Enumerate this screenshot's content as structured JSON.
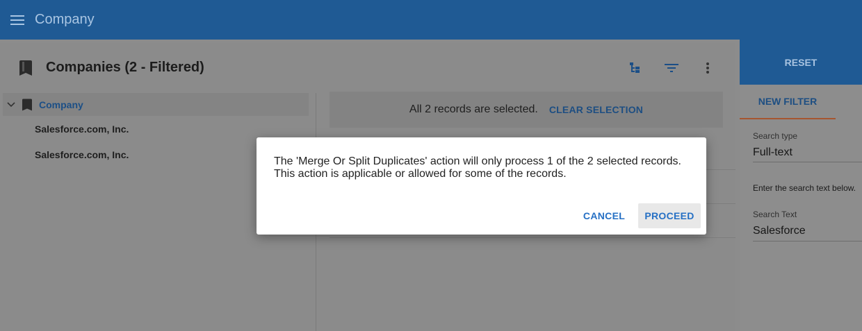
{
  "appbar": {
    "title": "Company"
  },
  "main": {
    "title": "Companies (2 - Filtered)"
  },
  "tree": {
    "root_label": "Company",
    "items": [
      "Salesforce.com, Inc.",
      "Salesforce.com, Inc."
    ]
  },
  "selection": {
    "text": "All 2 records are selected.",
    "clear_label": "CLEAR SELECTION"
  },
  "filter_panel": {
    "reset_label": "RESET",
    "new_filter_label": "NEW FILTER",
    "search_type_label": "Search type",
    "search_type_value": "Full-text",
    "hint": "Enter the search text below.",
    "search_text_label": "Search Text",
    "search_text_value": "Salesforce"
  },
  "dialog": {
    "line1": "The 'Merge Or Split Duplicates' action will only process 1 of the 2 selected records.",
    "line2": "This action is applicable or allowed for some of the records.",
    "cancel_label": "CANCEL",
    "proceed_label": "PROCEED"
  },
  "colors": {
    "appbar": "#1f5a94",
    "accent_text": "#2670c4",
    "tab_underline": "#a5552f"
  }
}
